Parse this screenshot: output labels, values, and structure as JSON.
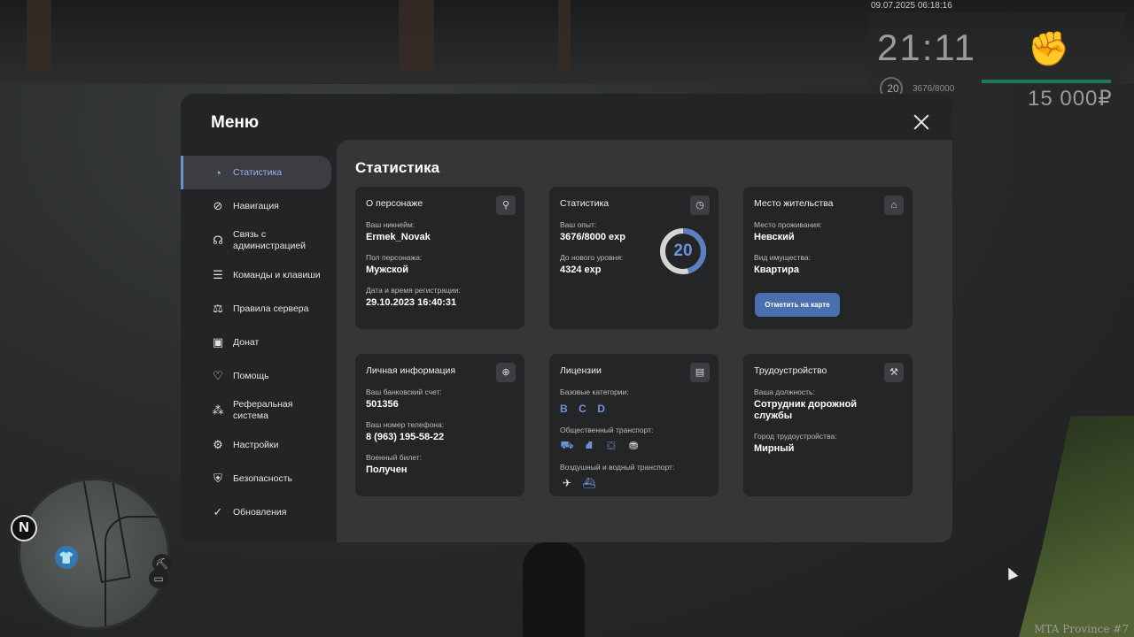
{
  "hud": {
    "datetime": "09.07.2025 06:18:16",
    "clock": "21:11",
    "level": "20",
    "exp": "3676/8000",
    "money": "15 000₽",
    "fist_icon": "fist-icon"
  },
  "minimap": {
    "north": "N"
  },
  "watermark": "MTA Province #7",
  "menu": {
    "title": "Меню",
    "sidebar": [
      {
        "label": "Статистика",
        "icon": "pie-chart-icon"
      },
      {
        "label": "Навигация",
        "icon": "compass-icon"
      },
      {
        "label": "Связь с администрацией",
        "icon": "headset-icon"
      },
      {
        "label": "Команды и клавиши",
        "icon": "list-icon"
      },
      {
        "label": "Правила сервера",
        "icon": "scales-icon"
      },
      {
        "label": "Донат",
        "icon": "wallet-icon"
      },
      {
        "label": "Помощь",
        "icon": "heart-hand-icon"
      },
      {
        "label": "Реферальная система",
        "icon": "network-icon"
      },
      {
        "label": "Настройки",
        "icon": "gear-icon"
      },
      {
        "label": "Безопасность",
        "icon": "shield-icon"
      },
      {
        "label": "Обновления",
        "icon": "check-circle-icon"
      }
    ],
    "content_title": "Статистика",
    "cards": {
      "character": {
        "title": "О персонаже",
        "nickname_label": "Ваш никнейм:",
        "nickname": "Ermek_Novak",
        "gender_label": "Пол персонажа:",
        "gender": "Мужской",
        "reg_label": "Дата и время регистрации:",
        "reg": "29.10.2023 16:40:31"
      },
      "stats": {
        "title": "Статистика",
        "exp_label": "Ваш опыт:",
        "exp": "3676/8000 exp",
        "next_label": "До нового уровня:",
        "next": "4324 exp",
        "level": "20",
        "level_progress": 0.4595
      },
      "residence": {
        "title": "Место жительства",
        "place_label": "Место проживания:",
        "place": "Невский",
        "property_label": "Вид имущества:",
        "property": "Квартира",
        "button": "Отметить на карте"
      },
      "personal": {
        "title": "Личная информация",
        "bank_label": "Ваш банковский счет:",
        "bank": "501356",
        "phone_label": "Ваш номер телефона:",
        "phone": "8 (963) 195-58-22",
        "military_label": "Военный билет:",
        "military": "Получен"
      },
      "licenses": {
        "title": "Лицензии",
        "base_label": "Базовые категории:",
        "categories": [
          "B",
          "C",
          "D"
        ],
        "public_label": "Общественный транспорт:",
        "air_label": "Воздушный и водный транспорт:"
      },
      "employment": {
        "title": "Трудоустройство",
        "position_label": "Ваша должность:",
        "position": "Сотрудник дорожной службы",
        "city_label": "Город трудоустройства:",
        "city": "Мирный"
      }
    }
  },
  "colors": {
    "accent": "#6d93d9",
    "button": "#4a6fae",
    "panel": "#232425",
    "content": "#353637",
    "card": "#242526"
  }
}
